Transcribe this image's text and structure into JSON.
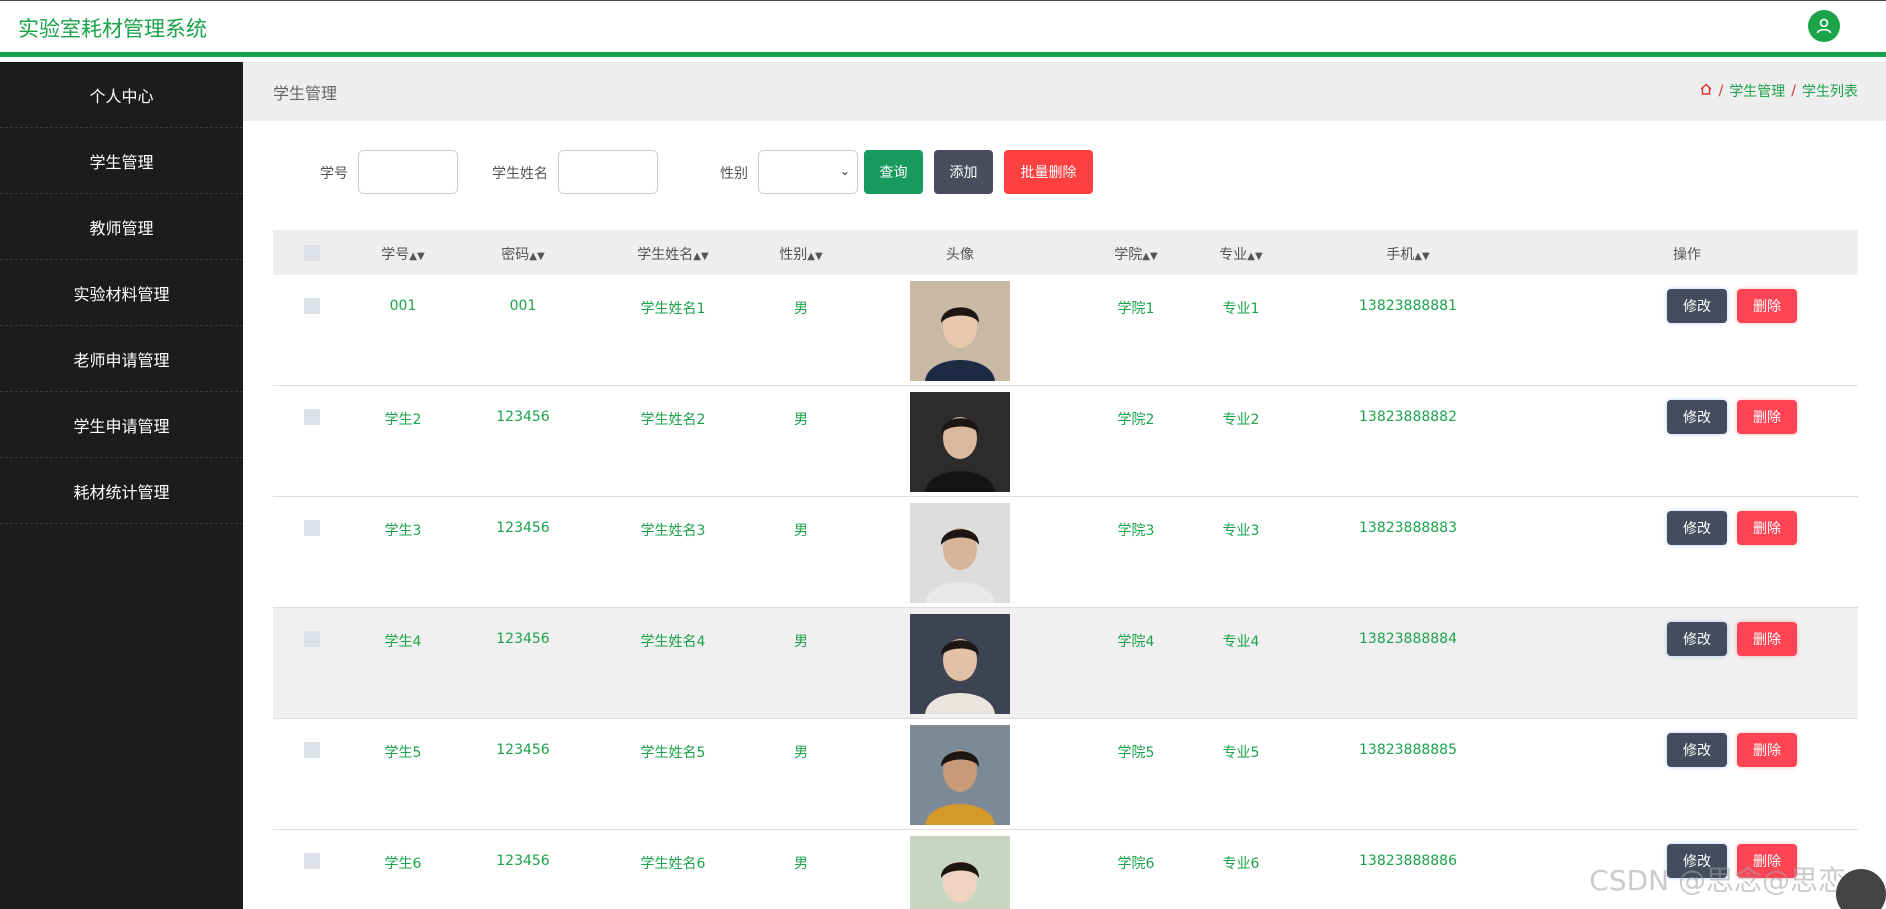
{
  "header": {
    "title": "实验室耗材管理系统",
    "user_icon": "user-icon"
  },
  "sidebar": {
    "items": [
      {
        "label": "个人中心"
      },
      {
        "label": "学生管理"
      },
      {
        "label": "教师管理"
      },
      {
        "label": "实验材料管理"
      },
      {
        "label": "老师申请管理"
      },
      {
        "label": "学生申请管理"
      },
      {
        "label": "耗材统计管理"
      }
    ]
  },
  "breadcrumb": {
    "page_title": "学生管理",
    "home_icon": "home-icon",
    "sep": "/",
    "level1": "学生管理",
    "level2": "学生列表"
  },
  "search": {
    "student_id_label": "学号",
    "student_id_value": "",
    "name_label": "学生姓名",
    "name_value": "",
    "gender_label": "性别",
    "gender_value": "",
    "query_label": "查询",
    "add_label": "添加",
    "bulk_delete_label": "批量删除"
  },
  "table": {
    "columns": [
      "学号",
      "密码",
      "学生姓名",
      "性别",
      "头像",
      "学院",
      "专业",
      "手机",
      "操作"
    ],
    "sortable": [
      true,
      true,
      true,
      true,
      false,
      true,
      true,
      true,
      false
    ],
    "edit_label": "修改",
    "delete_label": "删除",
    "rows": [
      {
        "id": "001",
        "password": "001",
        "name": "学生姓名1",
        "gender": "男",
        "college": "学院1",
        "major": "专业1",
        "phone": "13823888881"
      },
      {
        "id": "学生2",
        "password": "123456",
        "name": "学生姓名2",
        "gender": "男",
        "college": "学院2",
        "major": "专业2",
        "phone": "13823888882"
      },
      {
        "id": "学生3",
        "password": "123456",
        "name": "学生姓名3",
        "gender": "男",
        "college": "学院3",
        "major": "专业3",
        "phone": "13823888883"
      },
      {
        "id": "学生4",
        "password": "123456",
        "name": "学生姓名4",
        "gender": "男",
        "college": "学院4",
        "major": "专业4",
        "phone": "13823888884"
      },
      {
        "id": "学生5",
        "password": "123456",
        "name": "学生姓名5",
        "gender": "男",
        "college": "学院5",
        "major": "专业5",
        "phone": "13823888885"
      },
      {
        "id": "学生6",
        "password": "123456",
        "name": "学生姓名6",
        "gender": "男",
        "college": "学院6",
        "major": "专业6",
        "phone": "13823888886"
      }
    ]
  },
  "watermark": "CSDN @思念@思恋",
  "colors": {
    "accent": "#1aa34a",
    "sidebar": "#1c1c1c",
    "danger": "#ff4455",
    "dark_button": "#444c5e"
  }
}
